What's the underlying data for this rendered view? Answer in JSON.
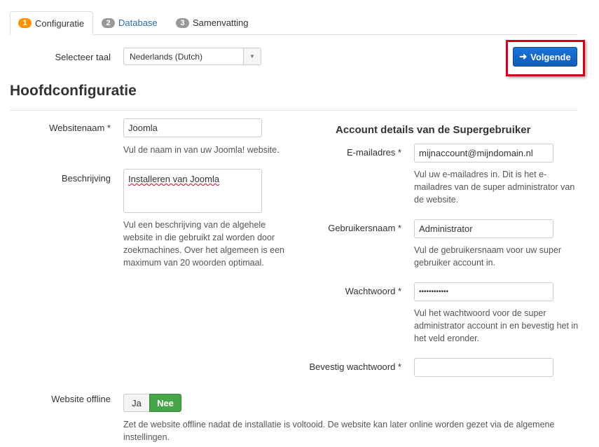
{
  "tabs": [
    {
      "number": "1",
      "label": "Configuratie",
      "active": true
    },
    {
      "number": "2",
      "label": "Database",
      "active": false
    },
    {
      "number": "3",
      "label": "Samenvatting",
      "active": false
    }
  ],
  "language": {
    "label": "Selecteer taal",
    "selected": "Nederlands (Dutch)"
  },
  "next_button": {
    "label": "Volgende",
    "icon": "arrow-right-icon"
  },
  "main_title": "Hoofdconfiguratie",
  "site": {
    "name_label": "Websitenaam *",
    "name_value": "Joomla",
    "name_help": "Vul de naam in van uw Joomla! website.",
    "description_label": "Beschrijving",
    "description_value": "Installeren van Joomla",
    "description_help": "Vul een beschrijving van de algehele website in die gebruikt zal worden door zoekmachines. Over het algemeen is een maximum van 20 woorden optimaal."
  },
  "account": {
    "title": "Account details van de Supergebruiker",
    "email_label": "E-mailadres *",
    "email_value": "mijnaccount@mijndomain.nl",
    "email_help": "Vul uw e-mailadres in. Dit is het e-mailadres van de super administrator van de website.",
    "username_label": "Gebruikersnaam *",
    "username_value": "Administrator",
    "username_help": "Vul de gebruikersnaam voor uw super gebruiker account in.",
    "password_label": "Wachtwoord *",
    "password_value": "••••••••••••",
    "password_help": "Vul het wachtwoord voor de super administrator account in en bevestig het in het veld eronder.",
    "confirm_label": "Bevestig wachtwoord *",
    "confirm_value": ""
  },
  "offline": {
    "label": "Website offline",
    "yes_label": "Ja",
    "no_label": "Nee",
    "selected": "Nee",
    "help": "Zet de website offline nadat de installatie is voltooid. De website kan later online worden gezet via de algemene instellingen."
  },
  "colors": {
    "primary": "#1565c8",
    "success": "#46a546",
    "highlight": "#d0021b",
    "badge_active": "#f89406",
    "badge_inactive": "#999999"
  }
}
